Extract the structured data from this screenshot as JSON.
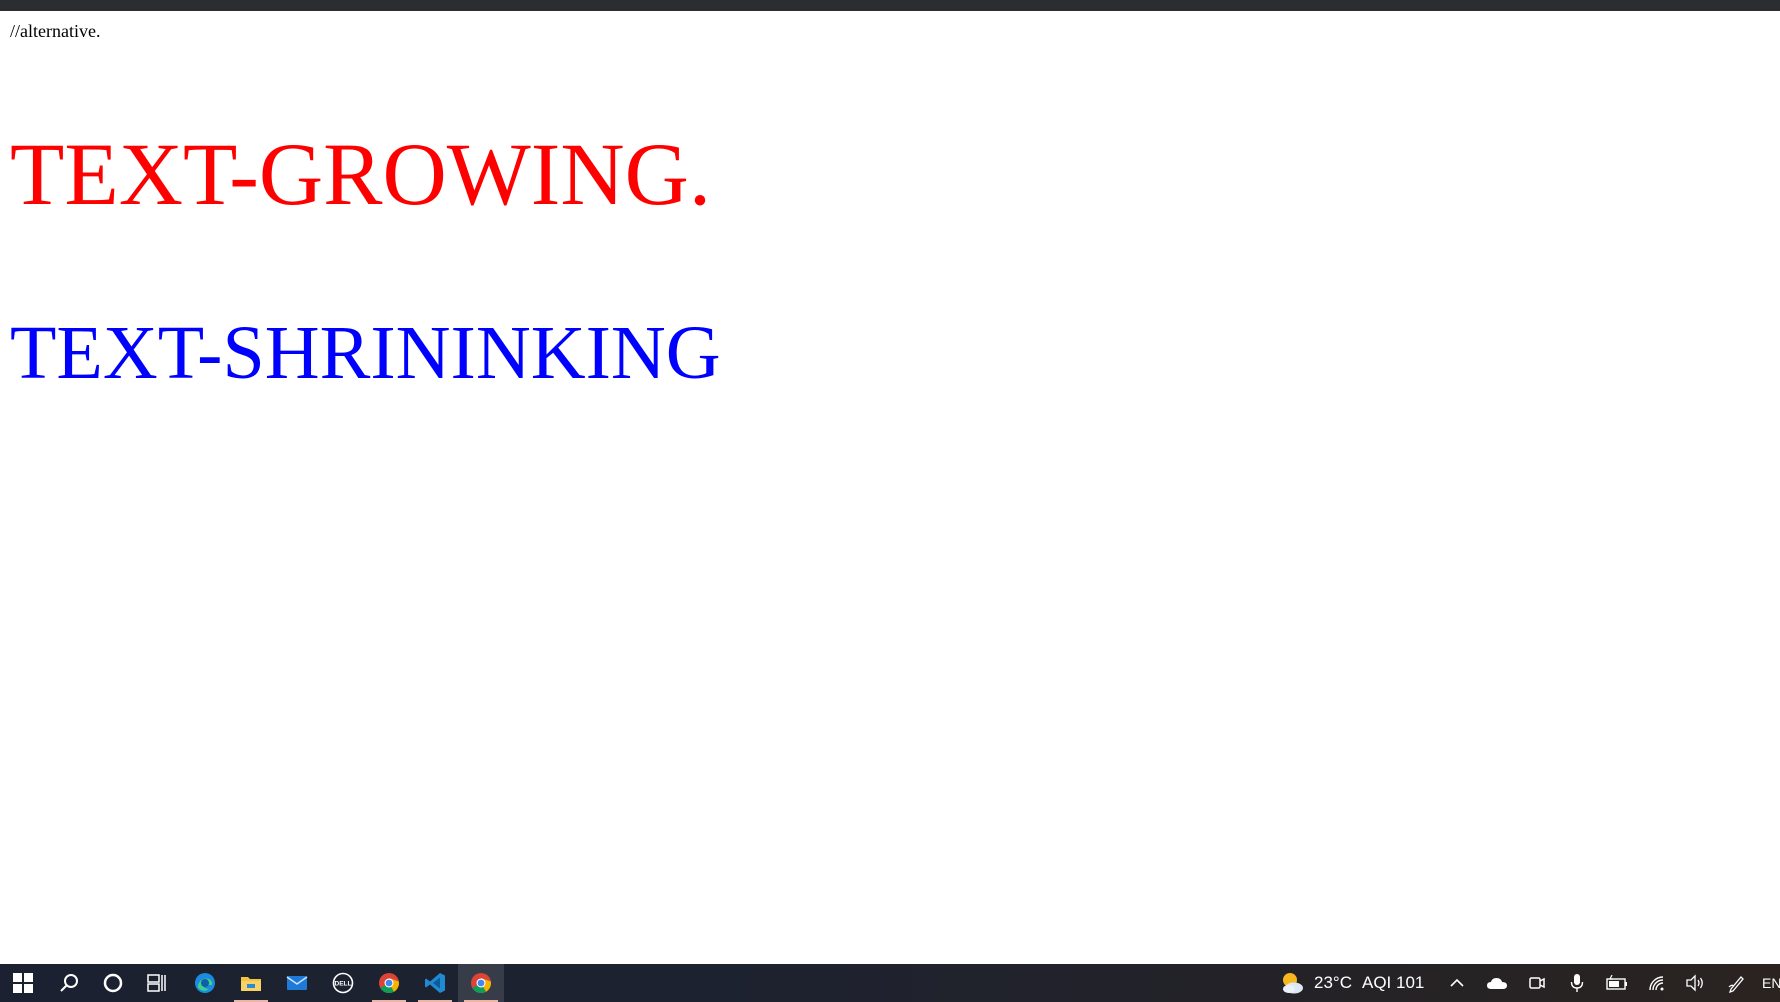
{
  "page": {
    "comment": "//alternative.",
    "growing_text": "TEXT-GROWING.",
    "shrinking_text": "TEXT-SHRININKING"
  },
  "colors": {
    "growing": "#ff0000",
    "shrinking": "#0000ff"
  },
  "taskbar": {
    "apps": [
      {
        "name": "start",
        "icon": "windows-logo-icon"
      },
      {
        "name": "search",
        "icon": "search-icon"
      },
      {
        "name": "cortana",
        "icon": "circle-icon"
      },
      {
        "name": "task-view",
        "icon": "task-view-icon"
      },
      {
        "name": "edge",
        "icon": "edge-icon"
      },
      {
        "name": "file-explorer",
        "icon": "folder-icon"
      },
      {
        "name": "mail",
        "icon": "mail-icon"
      },
      {
        "name": "dell",
        "icon": "dell-icon",
        "label": "DELL"
      },
      {
        "name": "chrome",
        "icon": "chrome-icon"
      },
      {
        "name": "vscode",
        "icon": "vscode-icon"
      },
      {
        "name": "chrome-active",
        "icon": "chrome-icon"
      }
    ],
    "weather": {
      "temperature": "23°C",
      "aqi": "AQI 101"
    },
    "language": "EN"
  }
}
